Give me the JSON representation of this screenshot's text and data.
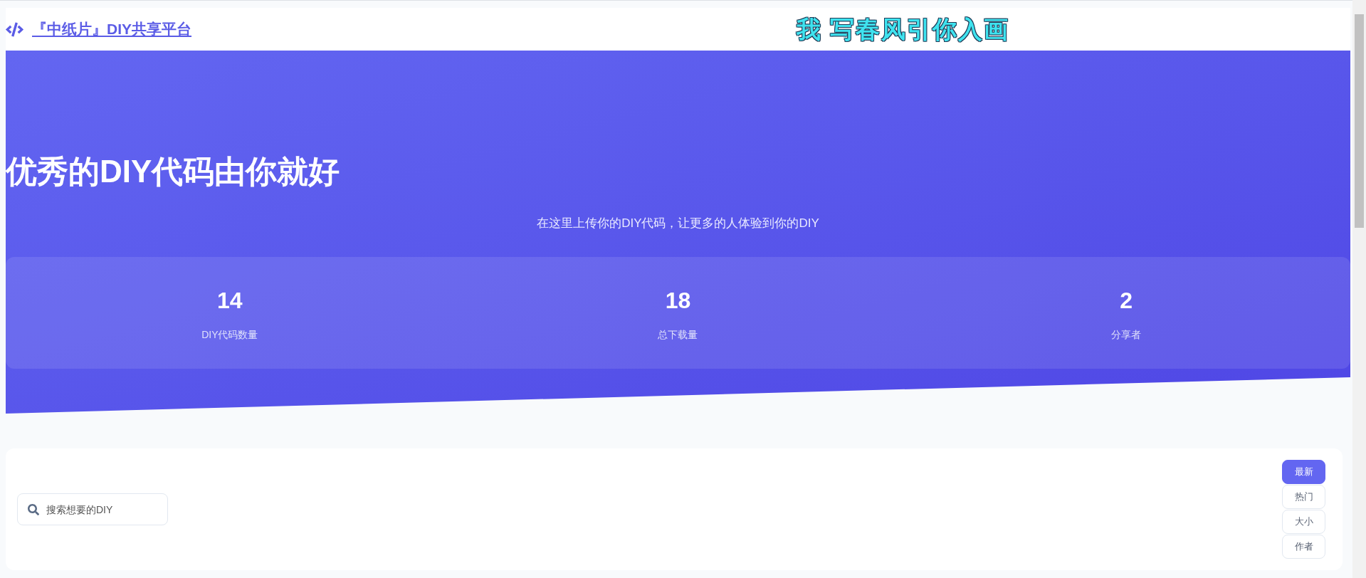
{
  "header": {
    "logo_text": "『中纸片』DIY共享平台",
    "slogan": "我 写春风引你入画"
  },
  "hero": {
    "title": "优秀的DIY代码由你就好",
    "subtitle": "在这里上传你的DIY代码，让更多的人体验到你的DIY"
  },
  "stats": [
    {
      "value": "14",
      "label": "DIY代码数量"
    },
    {
      "value": "18",
      "label": "总下载量"
    },
    {
      "value": "2",
      "label": "分享者"
    }
  ],
  "search": {
    "placeholder": "搜索想要的DIY"
  },
  "sort_buttons": [
    {
      "label": "最新",
      "selected": true
    },
    {
      "label": "热门",
      "selected": false
    },
    {
      "label": "大小",
      "selected": false
    },
    {
      "label": "作者",
      "selected": false
    }
  ]
}
